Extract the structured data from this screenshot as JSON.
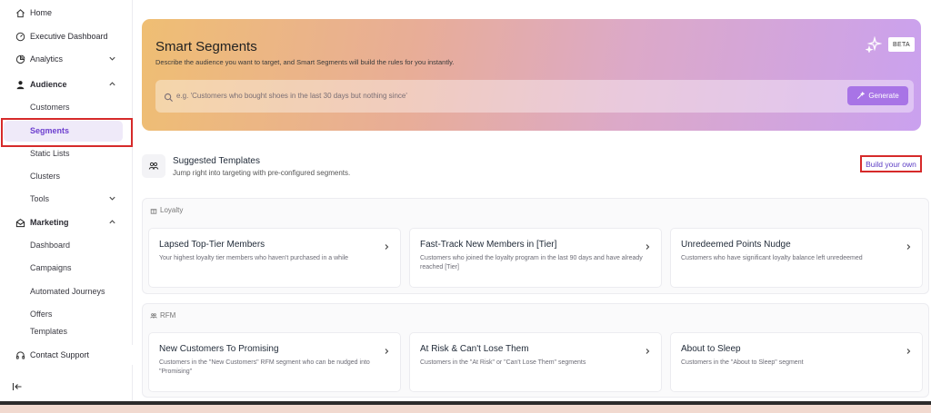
{
  "sidebar": {
    "items": [
      {
        "label": "Home",
        "icon": "home-icon"
      },
      {
        "label": "Executive Dashboard",
        "icon": "gauge-icon"
      },
      {
        "label": "Analytics",
        "icon": "chart-pie-icon"
      },
      {
        "label": "Audience",
        "icon": "user-icon"
      },
      {
        "label": "Marketing",
        "icon": "mail-open-icon"
      },
      {
        "label": "Contact Support",
        "icon": "headset-icon"
      }
    ],
    "audience_sub": [
      "Customers",
      "Segments",
      "Static Lists",
      "Clusters",
      "Tools"
    ],
    "marketing_sub": [
      "Dashboard",
      "Campaigns",
      "Automated Journeys",
      "Offers",
      "Templates"
    ],
    "active": "Segments"
  },
  "hero": {
    "title": "Smart Segments",
    "subtitle": "Describe the audience you want to target, and Smart Segments will build the rules for you instantly.",
    "badge": "BETA",
    "search_placeholder": "e.g. 'Customers who bought shoes in the last 30 days but nothing since'",
    "generate_label": "Generate"
  },
  "templates": {
    "title": "Suggested Templates",
    "subtitle": "Jump right into targeting with pre-configured segments.",
    "build_own_label": "Build your own"
  },
  "sections": [
    {
      "label": "Loyalty",
      "cards": [
        {
          "title": "Lapsed Top-Tier Members",
          "desc": "Your highest loyalty tier members who haven't purchased in a while"
        },
        {
          "title": "Fast-Track New Members in [Tier]",
          "desc": "Customers who joined the loyalty program in the last 90 days and have already reached [Tier]"
        },
        {
          "title": "Unredeemed Points Nudge",
          "desc": "Customers who have significant loyalty balance left unredeemed"
        }
      ]
    },
    {
      "label": "RFM",
      "cards": [
        {
          "title": "New Customers To Promising",
          "desc": "Customers in the \"New Customers\" RFM segment who can be nudged into \"Promising\""
        },
        {
          "title": "At Risk & Can't Lose Them",
          "desc": "Customers in the \"At Risk\" or \"Can't Lose Them\" segments"
        },
        {
          "title": "About to Sleep",
          "desc": "Customers in the \"About to Sleep\" segment"
        }
      ]
    }
  ],
  "colors": {
    "accent": "#6d3fcf",
    "highlight": "#d62a2a",
    "generate": "#a874e6"
  }
}
